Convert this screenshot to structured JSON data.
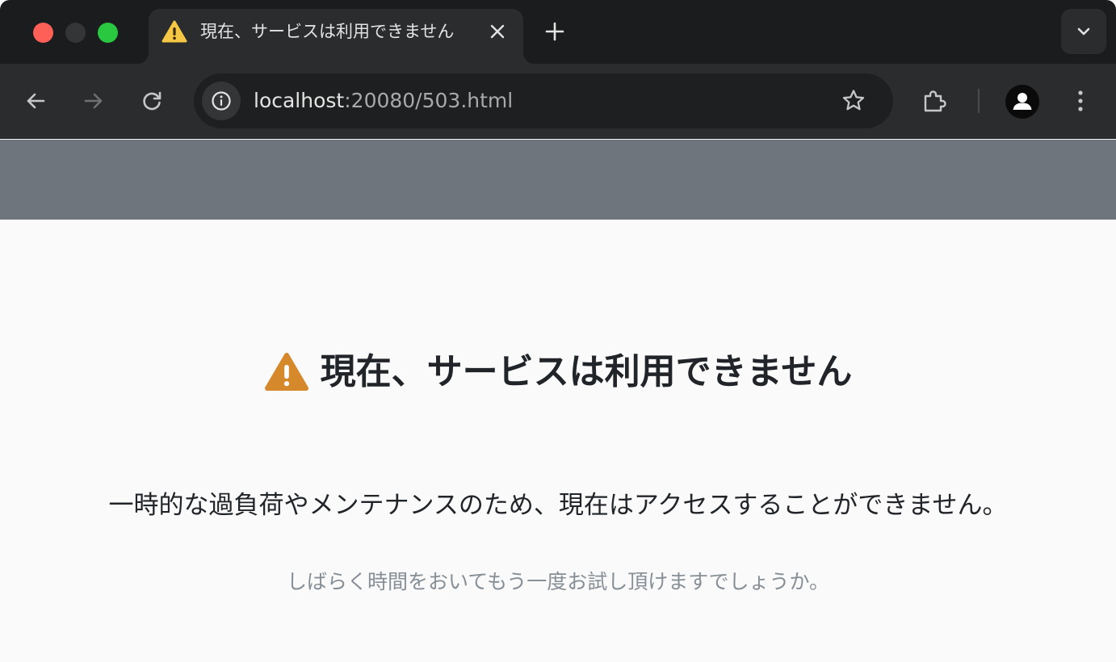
{
  "browser": {
    "tab": {
      "title": "現在、サービスは利用できません",
      "favicon": "warning-icon"
    },
    "address_bar": {
      "host": "localhost",
      "path": ":20080/503.html"
    },
    "icons": {
      "back": "arrow-left-icon",
      "forward": "arrow-right-icon",
      "reload": "reload-icon",
      "site_info": "info-icon",
      "bookmark": "star-icon",
      "extensions": "puzzle-icon",
      "profile": "person-icon",
      "menu": "kebab-menu-icon",
      "new_tab": "plus-icon",
      "tab_search": "chevron-down-icon",
      "close_tab": "close-icon"
    }
  },
  "page": {
    "title": "現在、サービスは利用できません",
    "message": "一時的な過負荷やメンテナンスのため、現在はアクセスすることができません。",
    "sub_message": "しばらく時間をおいてもう一度お試し頂けますでしょうか。"
  },
  "colors": {
    "banner": "#6e757d",
    "warning_icon": "#d6892b",
    "heading_text": "#212529",
    "muted_text": "#868e96",
    "close_red": "#fe5f57",
    "zoom_green": "#29c840"
  }
}
